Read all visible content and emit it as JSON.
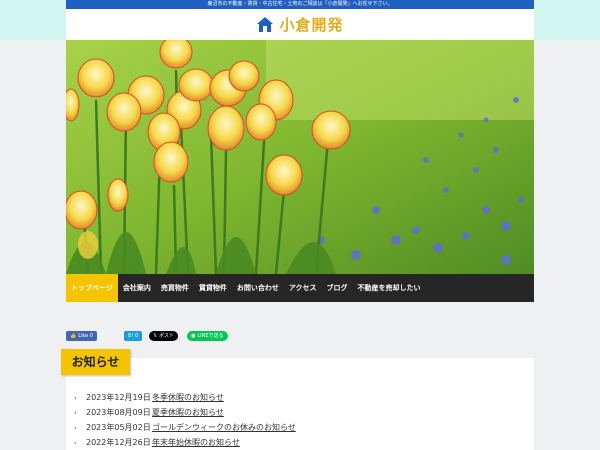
{
  "header": {
    "tagline": "鹿沼市の不動産・賃貸・中古住宅・土地のご相談は「小倉開発」へお任せ下さい。",
    "logo_text": "小倉開発",
    "logo_icon": "house-icon",
    "brand_blue": "#1f5fbf",
    "brand_gold": "#e3ae1e"
  },
  "hero": {
    "image": "tulips-photo"
  },
  "nav": {
    "items": [
      {
        "label": "トップページ",
        "active": true
      },
      {
        "label": "会社案内"
      },
      {
        "label": "売買物件"
      },
      {
        "label": "賃貸物件"
      },
      {
        "label": "お問い合わせ"
      },
      {
        "label": "アクセス"
      },
      {
        "label": "ブログ"
      },
      {
        "label": "不動産を売却したい"
      }
    ],
    "active_color": "#f4c400"
  },
  "social": {
    "facebook": "Like 0",
    "hatena": "B! 0",
    "x": "ポスト",
    "line": "LINEで送る"
  },
  "news": {
    "title": "お知らせ",
    "items": [
      {
        "date": "2023年12月19日",
        "title": "冬季休暇のお知らせ"
      },
      {
        "date": "2023年08月09日",
        "title": "夏季休暇のお知らせ"
      },
      {
        "date": "2023年05月02日",
        "title": "ゴールデンウィークのお休みのお知らせ"
      },
      {
        "date": "2022年12月26日",
        "title": "年末年始休暇のお知らせ"
      }
    ]
  }
}
